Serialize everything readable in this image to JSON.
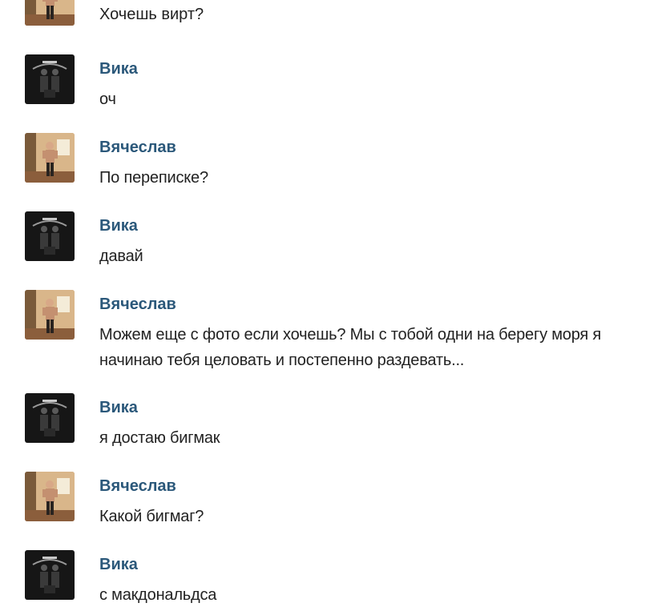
{
  "colors": {
    "author": "#2b587a",
    "text": "#222222",
    "background": "#ffffff"
  },
  "messages": [
    {
      "author": "",
      "text": "Хочешь вирт?",
      "avatar": "photo-man-icon"
    },
    {
      "author": "Вика",
      "text": "оч",
      "avatar": "dark-photo-icon"
    },
    {
      "author": "Вячеслав",
      "text": "По переписке?",
      "avatar": "photo-man-icon"
    },
    {
      "author": "Вика",
      "text": "давай",
      "avatar": "dark-photo-icon"
    },
    {
      "author": "Вячеслав",
      "text": "Можем еще с фото если хочешь? Мы с тобой одни на берегу моря я начинаю тебя целовать и постепенно раздевать...",
      "avatar": "photo-man-icon"
    },
    {
      "author": "Вика",
      "text": "я достаю бигмак",
      "avatar": "dark-photo-icon"
    },
    {
      "author": "Вячеслав",
      "text": "Какой бигмаг?",
      "avatar": "photo-man-icon"
    },
    {
      "author": "Вика",
      "text": "с макдональдса",
      "avatar": "dark-photo-icon"
    }
  ]
}
